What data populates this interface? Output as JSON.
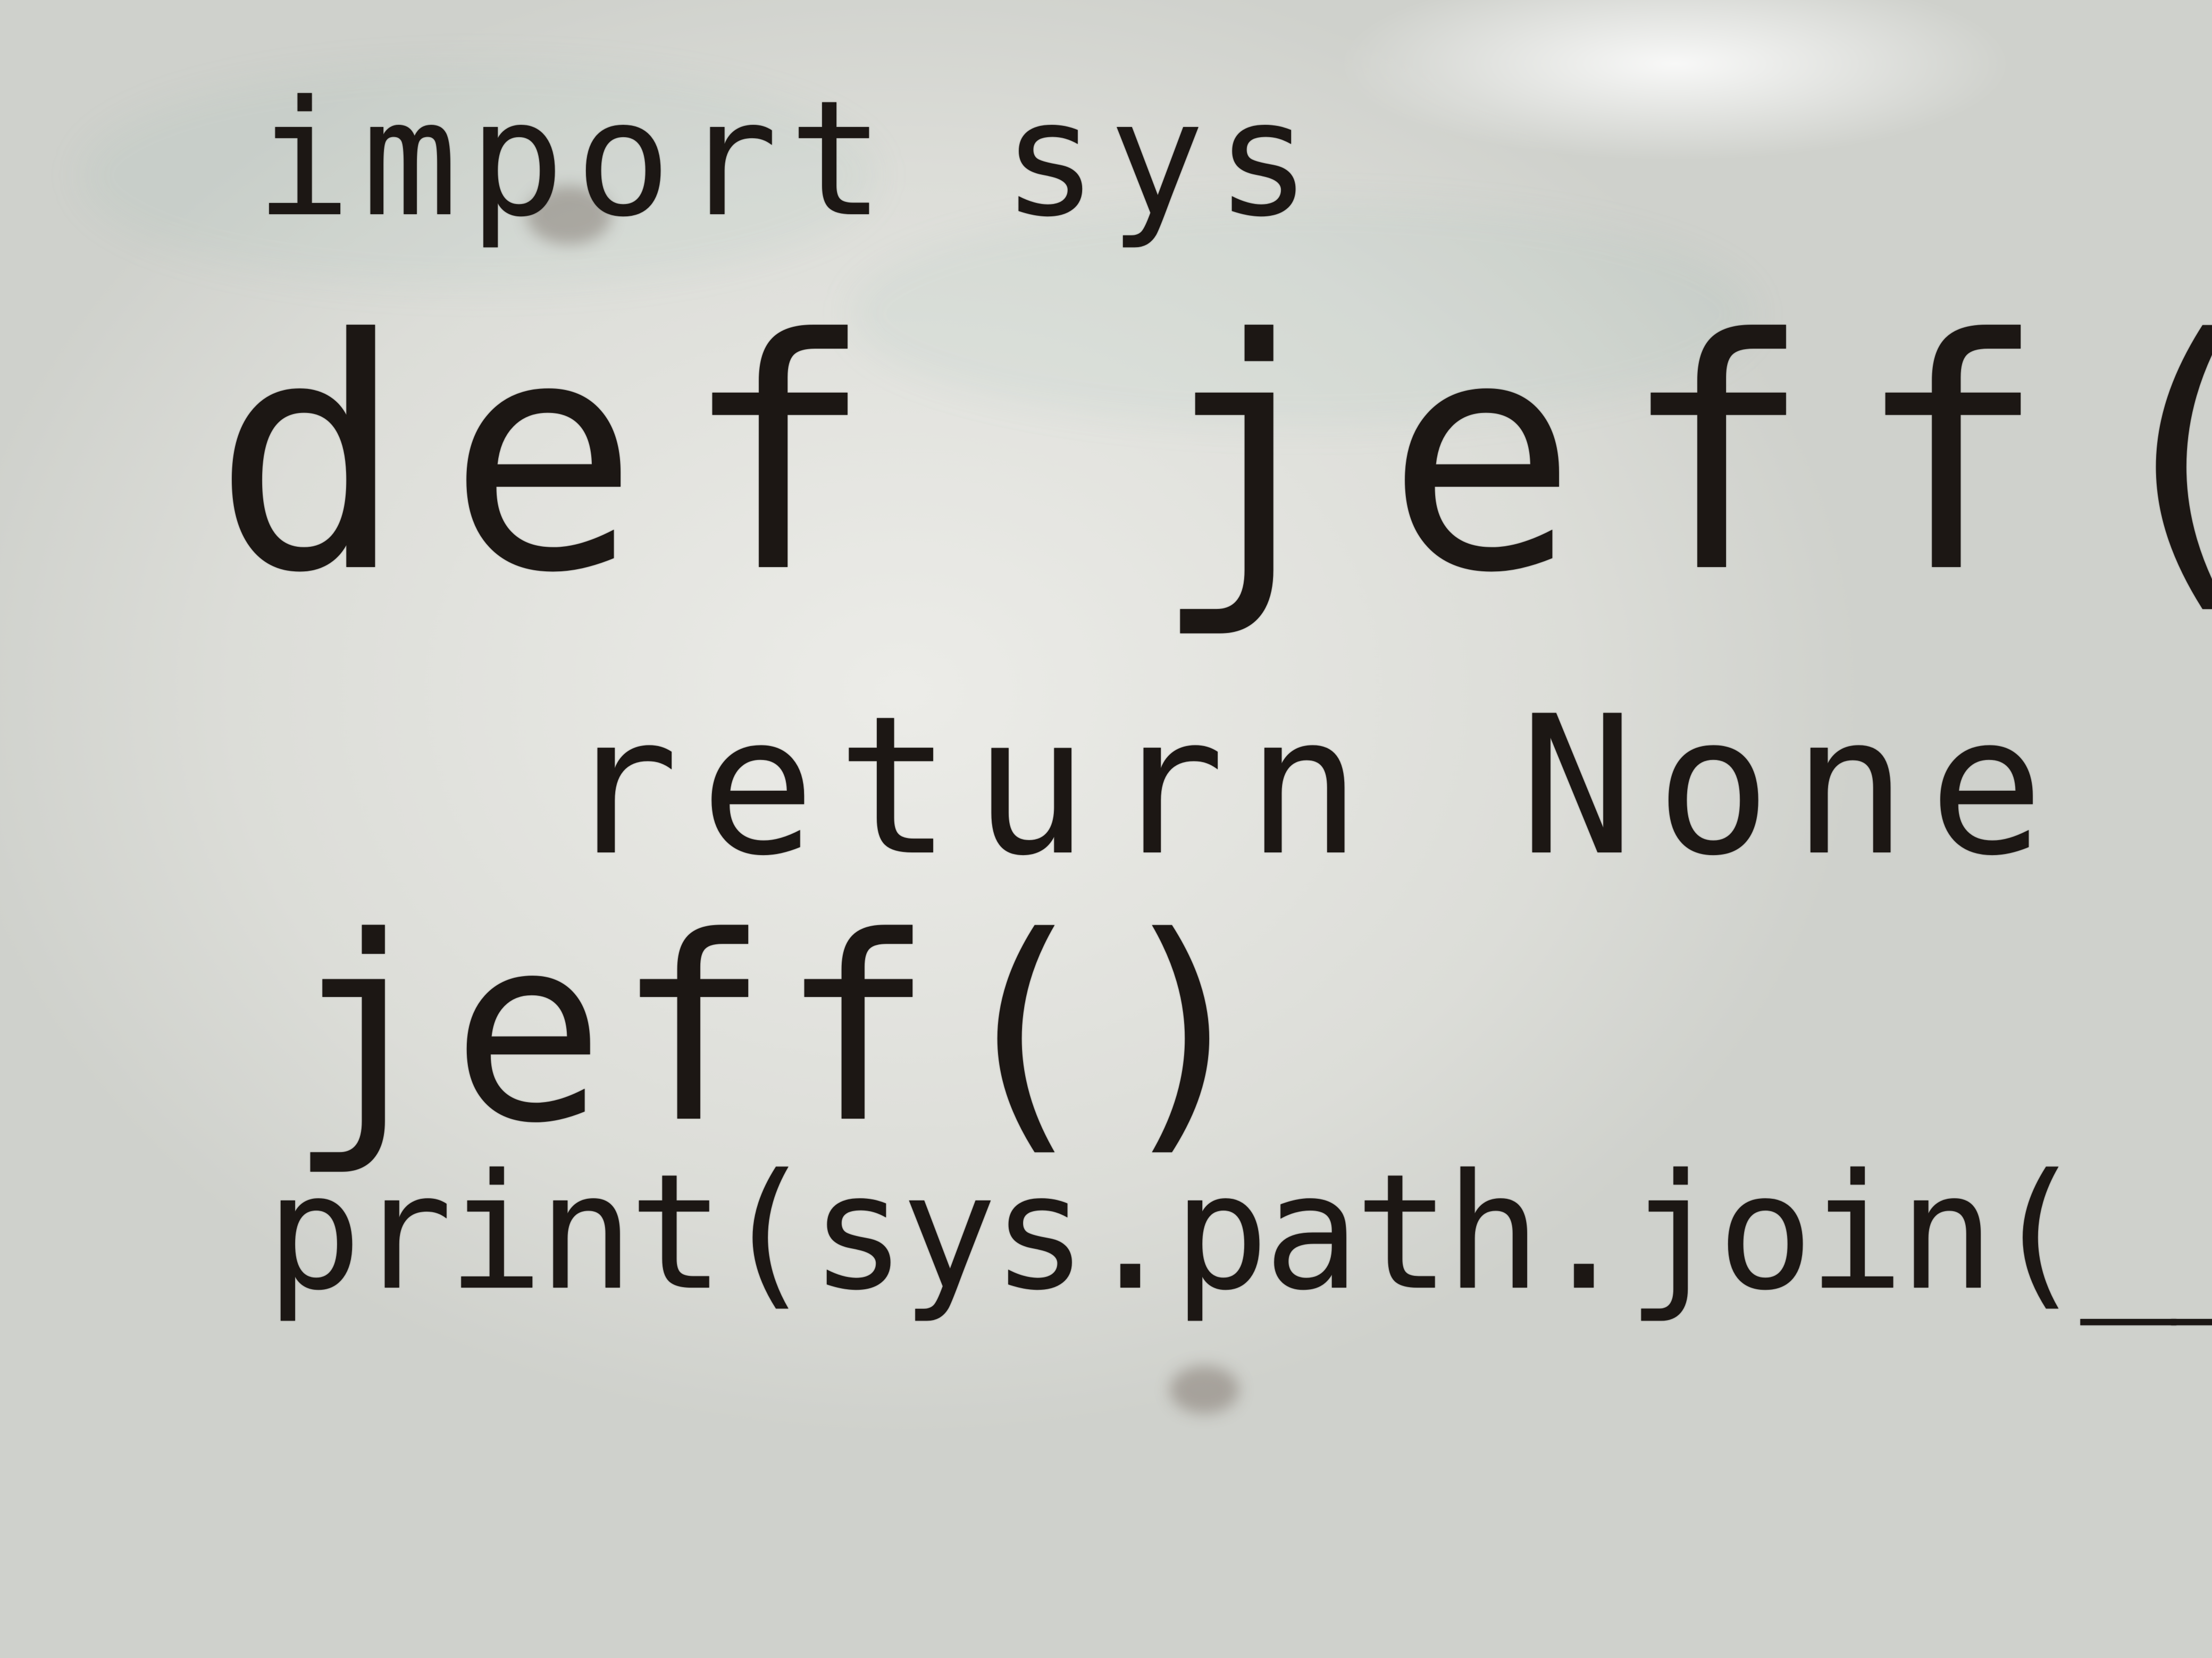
{
  "whiteboard": {
    "lines": [
      "import sys",
      "def jeff():",
      "return None",
      "jeff()",
      "print(sys.path.join(__file__))"
    ]
  },
  "colors": {
    "board": "#e6e7e2",
    "marker": "#1c1714"
  }
}
